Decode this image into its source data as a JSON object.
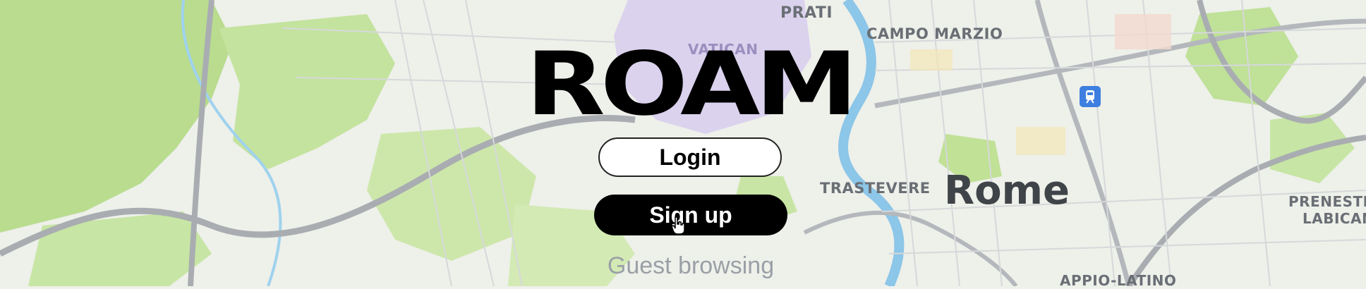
{
  "app": {
    "logo_text": "ROAM"
  },
  "auth": {
    "login_label": "Login",
    "signup_label": "Sign up",
    "guest_label": "Guest browsing"
  },
  "map": {
    "city_label": "Rome",
    "places": {
      "prati": "PRATI",
      "vatican": "VATICAN",
      "campo_marzio": "CAMPO MARZIO",
      "trastevere": "TRASTEVERE",
      "prenestino": "PRENESTIN",
      "labicano": "LABICAN",
      "appio_latino": "APPIO-LATINO"
    },
    "colors": {
      "park_green": "#b9dc8f",
      "land": "#eef0ea",
      "river": "#8cc6e8",
      "road": "#a9adb1",
      "vatican_overlay": "#c9bde8",
      "metro_blue": "#3d7fe0"
    },
    "icons": [
      "metro-station-icon",
      "pointer-cursor-icon"
    ]
  }
}
